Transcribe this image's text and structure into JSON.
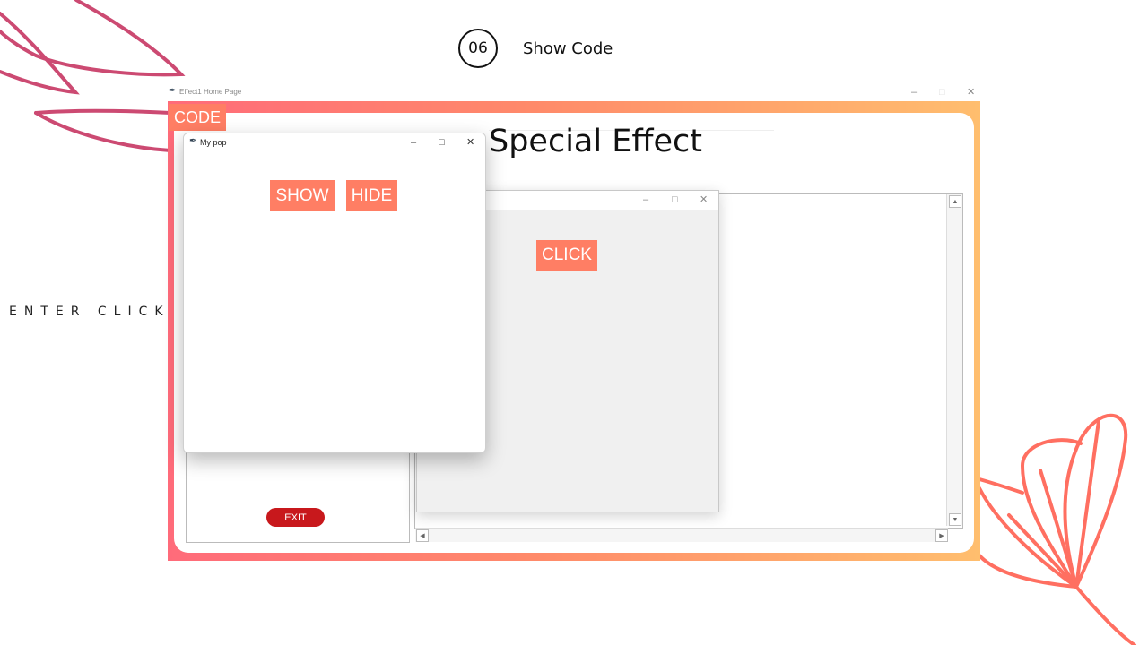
{
  "slide": {
    "number": "06",
    "title": "Show Code",
    "side_caption": "ENTER CLICK"
  },
  "main_window": {
    "title": "Effect1 Home Page",
    "code_tag": "CODE",
    "heading": "Special Effect",
    "exit_label": "EXIT",
    "controls": {
      "minimize": "–",
      "maximize": "□",
      "close": "✕"
    }
  },
  "popup_main": {
    "title": "My pop",
    "show_label": "SHOW",
    "hide_label": "HIDE",
    "controls": {
      "minimize": "–",
      "maximize": "□",
      "close": "✕"
    }
  },
  "popup_second": {
    "click_label": "CLICK",
    "controls": {
      "minimize": "–",
      "maximize": "□",
      "close": "✕"
    }
  },
  "scrollbar": {
    "up": "▲",
    "down": "▼",
    "left": "◀",
    "right": "▶"
  },
  "icons": {
    "app": "feather-icon"
  },
  "colors": {
    "accent": "#ff7e64",
    "exit": "#c8181c",
    "gradient_start": "#ff6b7a",
    "gradient_end": "#ffbe6e",
    "deco_pink": "#cc4a72",
    "deco_coral": "#ff6f61"
  }
}
